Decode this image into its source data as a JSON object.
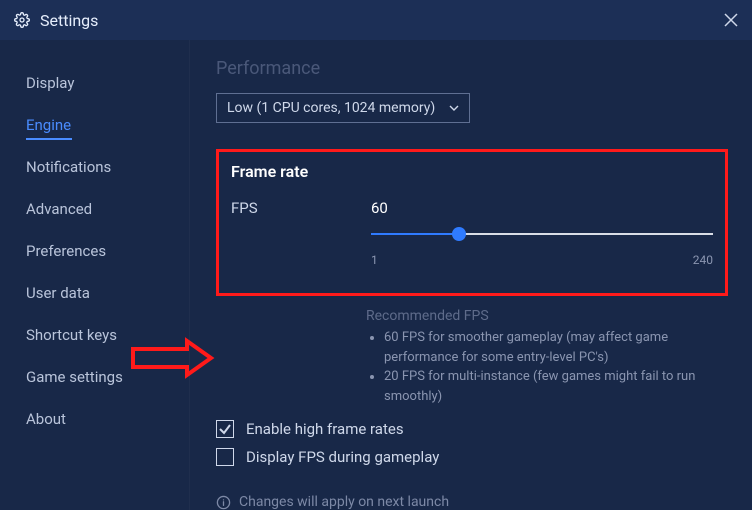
{
  "title": "Settings",
  "sidebar": {
    "items": [
      {
        "label": "Display"
      },
      {
        "label": "Engine"
      },
      {
        "label": "Notifications"
      },
      {
        "label": "Advanced"
      },
      {
        "label": "Preferences"
      },
      {
        "label": "User data"
      },
      {
        "label": "Shortcut keys"
      },
      {
        "label": "Game settings"
      },
      {
        "label": "About"
      }
    ],
    "active_index": 1
  },
  "performance": {
    "heading": "Performance",
    "dropdown_value": "Low (1 CPU cores, 1024 memory)"
  },
  "frame_rate": {
    "section_title": "Frame rate",
    "label": "FPS",
    "value": "60",
    "min": "1",
    "max": "240",
    "recommended_title": "Recommended FPS",
    "recommended": [
      "60 FPS for smoother gameplay (may affect game performance for some entry-level PC's)",
      "20 FPS for multi-instance (few games might fail to run smoothly)"
    ]
  },
  "checkboxes": {
    "enable_high_fps": {
      "label": "Enable high frame rates",
      "checked": true
    },
    "display_fps": {
      "label": "Display FPS during gameplay",
      "checked": false
    }
  },
  "note": "Changes will apply on next launch",
  "annotation": {
    "highlight": "frame-rate-section",
    "arrow_target": "enable-high-frame-rates-checkbox"
  }
}
